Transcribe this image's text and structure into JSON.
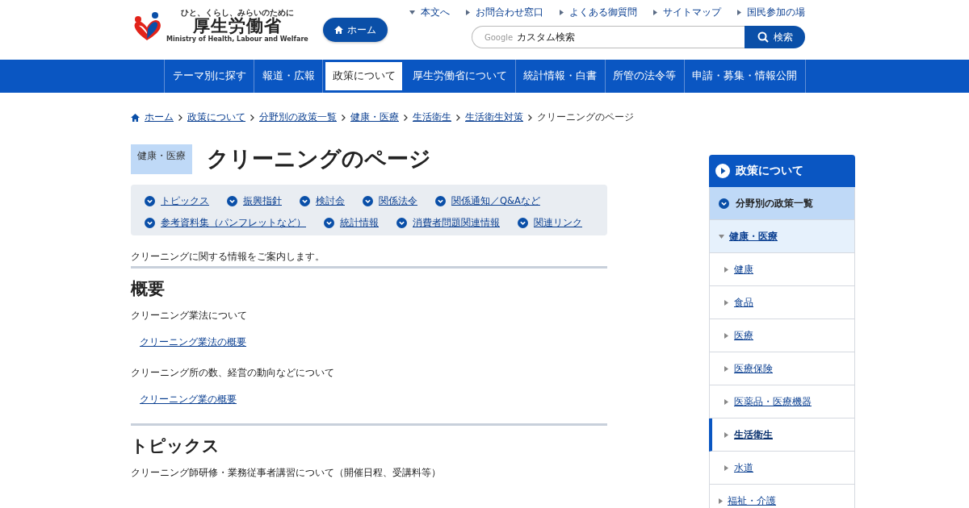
{
  "header": {
    "logo": {
      "tagline": "ひと、くらし、みらいのために",
      "name": "厚生労働省",
      "english": "Ministry of Health, Labour and Welfare"
    },
    "home_button": "ホーム",
    "utility_links": [
      {
        "label": "本文へ",
        "kind": "down"
      },
      {
        "label": "お問合わせ窓口",
        "kind": "right"
      },
      {
        "label": "よくある御質問",
        "kind": "right"
      },
      {
        "label": "サイトマップ",
        "kind": "right"
      },
      {
        "label": "国民参加の場",
        "kind": "right"
      }
    ],
    "search": {
      "brand": "Google",
      "placeholder": "カスタム検索",
      "button": "検索"
    }
  },
  "nav": [
    {
      "label": "テーマ別に探す",
      "selected": false
    },
    {
      "label": "報道・広報",
      "selected": false
    },
    {
      "label": "政策について",
      "selected": true
    },
    {
      "label": "厚生労働省について",
      "selected": false
    },
    {
      "label": "統計情報・白書",
      "selected": false
    },
    {
      "label": "所管の法令等",
      "selected": false
    },
    {
      "label": "申請・募集・情報公開",
      "selected": false
    }
  ],
  "breadcrumb": {
    "links": [
      "ホーム",
      "政策について",
      "分野別の政策一覧",
      "健康・医療",
      "生活衛生",
      "生活衛生対策"
    ],
    "current": "クリーニングのページ"
  },
  "page": {
    "category": "健康・医療",
    "title": "クリーニングのページ"
  },
  "anchor_links": [
    [
      "トピックス",
      "振興指針",
      "検討会",
      "関係法令",
      "関係通知／Q&Aなど"
    ],
    [
      "参考資料集（パンフレットなど）",
      "統計情報",
      "消費者問題関連情報",
      "関連リンク"
    ]
  ],
  "intro": "クリーニングに関する情報をご案内します。",
  "sections": [
    {
      "heading": "概要",
      "items": [
        {
          "kind": "text",
          "text": "クリーニング業法について"
        },
        {
          "kind": "link",
          "text": "クリーニング業法の概要"
        },
        {
          "kind": "text",
          "text": "クリーニング所の数、経営の動向などについて"
        },
        {
          "kind": "link",
          "text": "クリーニング業の概要"
        }
      ]
    },
    {
      "heading": "トピックス",
      "items": [
        {
          "kind": "text",
          "text": "クリーニング師研修・業務従事者講習について（開催日程、受講料等）"
        }
      ]
    }
  ],
  "sidebar": {
    "title": "政策について",
    "items": [
      {
        "label": "分野別の政策一覧",
        "expanded": true,
        "children": [
          {
            "label": "健康・医療",
            "expanded": true,
            "children": [
              {
                "label": "健康",
                "selected": false
              },
              {
                "label": "食品",
                "selected": false
              },
              {
                "label": "医療",
                "selected": false
              },
              {
                "label": "医療保険",
                "selected": false
              },
              {
                "label": "医薬品・医療機器",
                "selected": false
              },
              {
                "label": "生活衛生",
                "selected": true
              },
              {
                "label": "水道",
                "selected": false
              }
            ]
          },
          {
            "label": "福祉・介護",
            "expanded": false
          }
        ]
      }
    ]
  }
}
